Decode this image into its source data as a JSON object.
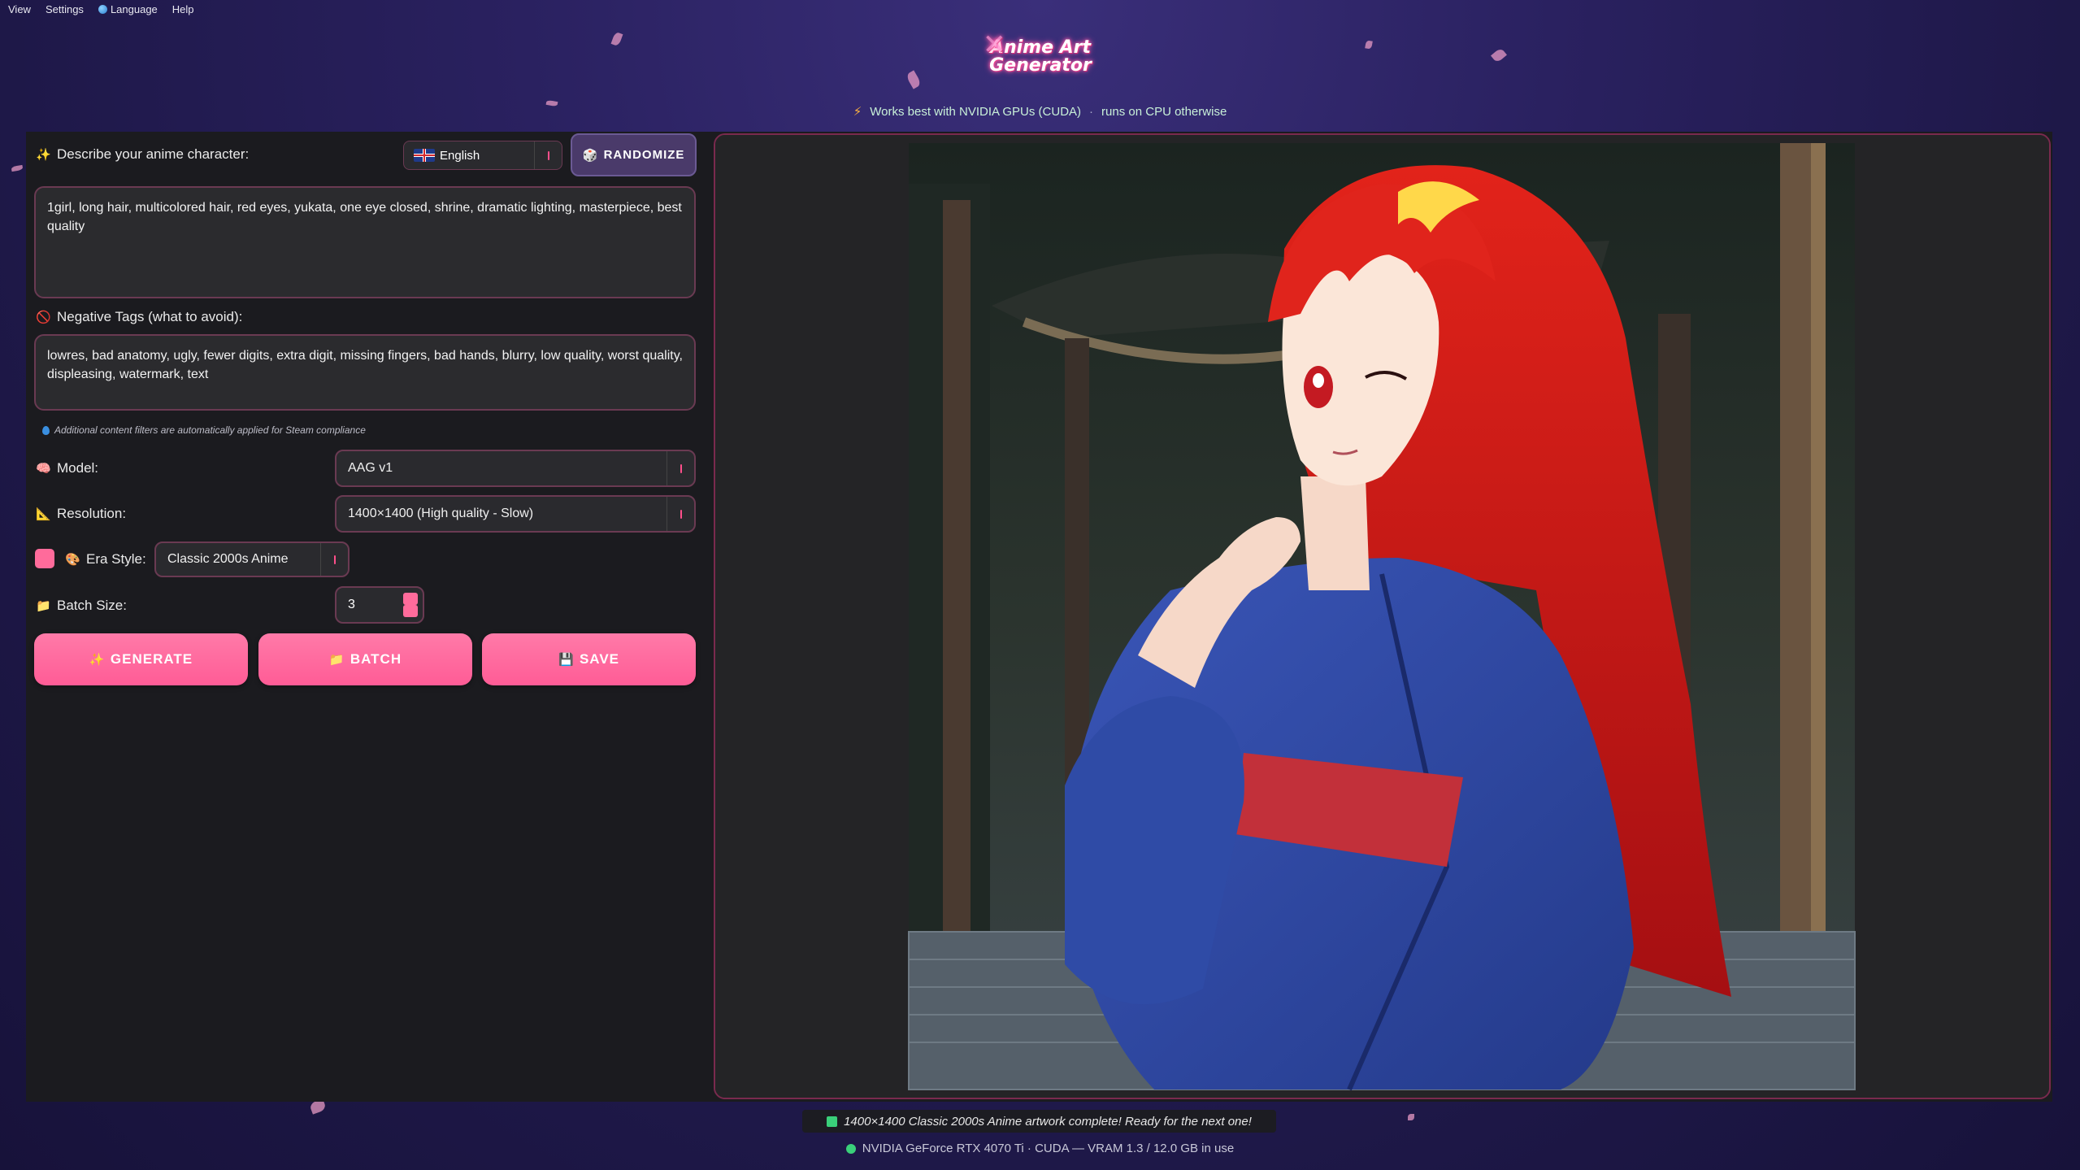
{
  "menu": {
    "view": "View",
    "settings": "Settings",
    "language": "Language",
    "help": "Help"
  },
  "header": {
    "logo_line1": "Anime Art",
    "logo_line2": "Generator",
    "notice_part1": "Works best with NVIDIA GPUs (CUDA)",
    "notice_part2": "runs on CPU otherwise"
  },
  "prompt": {
    "label": "Describe your anime character:",
    "value": "1girl, long hair, multicolored hair, red eyes, yukata, one eye closed, shrine, dramatic lighting, masterpiece, best quality"
  },
  "language_select": {
    "value": "English"
  },
  "randomize_label": "RANDOMIZE",
  "negative": {
    "label": "Negative Tags (what to avoid):",
    "value": "lowres, bad anatomy, ugly, fewer digits, extra digit, missing fingers, bad hands, blurry, low quality, worst quality, displeasing, watermark, text"
  },
  "filter_note": "Additional content filters are automatically applied for Steam compliance",
  "model": {
    "label": "Model:",
    "value": "AAG v1"
  },
  "resolution": {
    "label": "Resolution:",
    "value": "1400×1400 (High quality - Slow)"
  },
  "era": {
    "label": "Era Style:",
    "value": "Classic 2000s Anime",
    "enabled": true
  },
  "batch": {
    "label": "Batch Size:",
    "value": "3"
  },
  "buttons": {
    "generate": "GENERATE",
    "batch": "BATCH",
    "save": "SAVE"
  },
  "status_message": "1400×1400 Classic 2000s Anime artwork complete! Ready for the next one!",
  "gpu_status": "NVIDIA GeForce RTX 4070 Ti · CUDA — VRAM 1.3 / 12.0 GB in use",
  "colors": {
    "accent": "#ff6b9b",
    "panel": "#1b1b1f",
    "border": "#6a3a52",
    "background": "#241d55"
  }
}
